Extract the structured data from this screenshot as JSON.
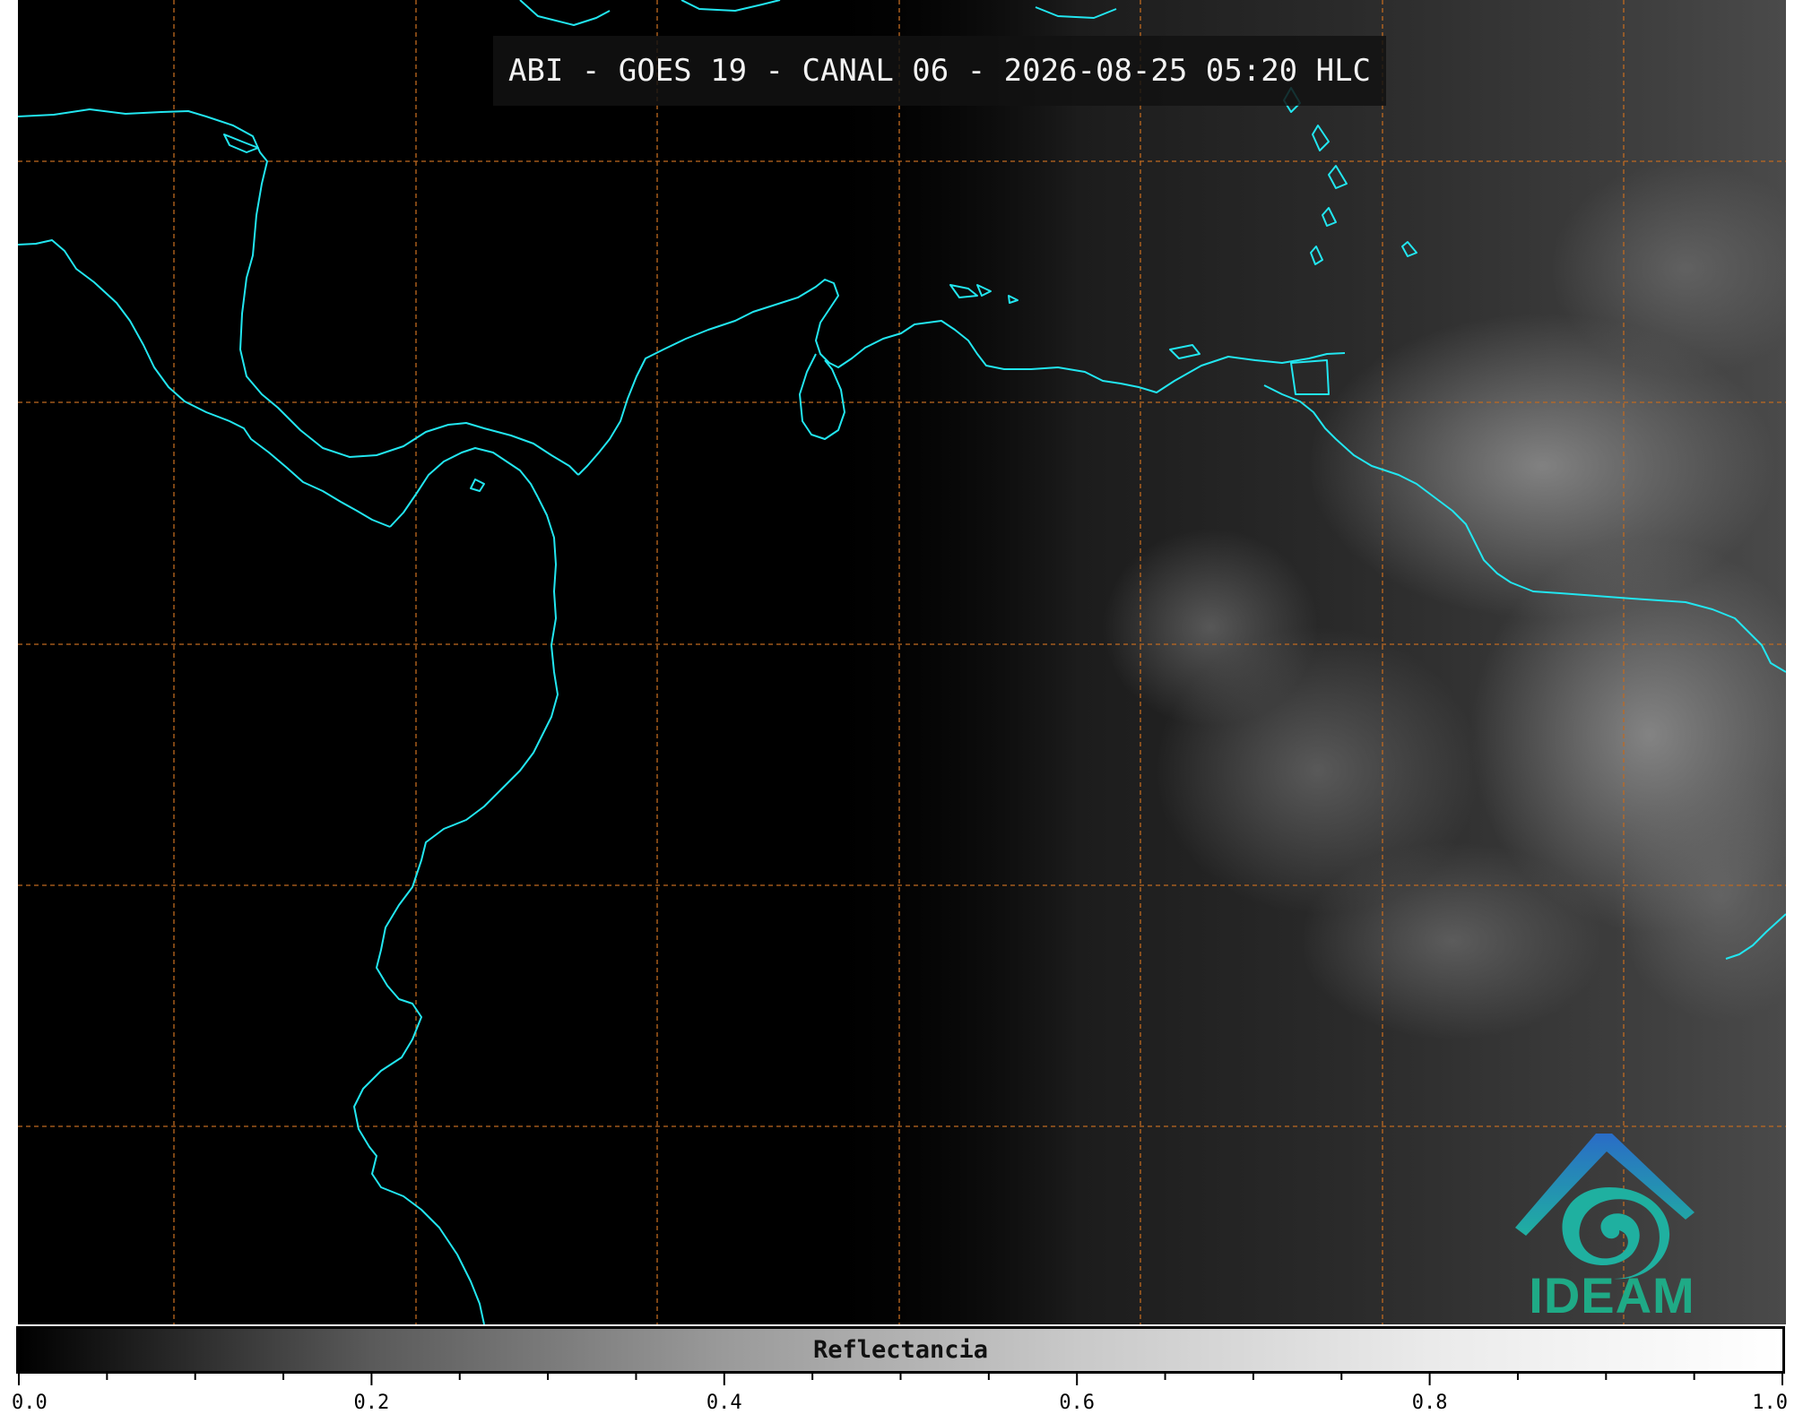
{
  "title": "ABI - GOES 19 - CANAL 06 - 2026-08-25 05:20 HLC",
  "map": {
    "background_color": "#000000",
    "coastline_color": "#22e6f0",
    "grid_color": "#c06a20",
    "grid_style": "dashed",
    "illuminated_region": "east"
  },
  "logo": {
    "text": "IDEAM",
    "icon": "ideam-mountain-swirl-icon",
    "colors": [
      "#2a6cc7",
      "#1fb0a0",
      "#1faa86"
    ]
  },
  "colorbar": {
    "label": "Reflectancia",
    "min": 0.0,
    "max": 1.0,
    "tick_labels": [
      "0.0",
      "0.2",
      "0.4",
      "0.6",
      "0.8",
      "1.0"
    ],
    "tick_values": [
      0.0,
      0.2,
      0.4,
      0.6,
      0.8,
      1.0
    ],
    "minor_tick_step": 0.05,
    "colormap": "grayscale"
  }
}
